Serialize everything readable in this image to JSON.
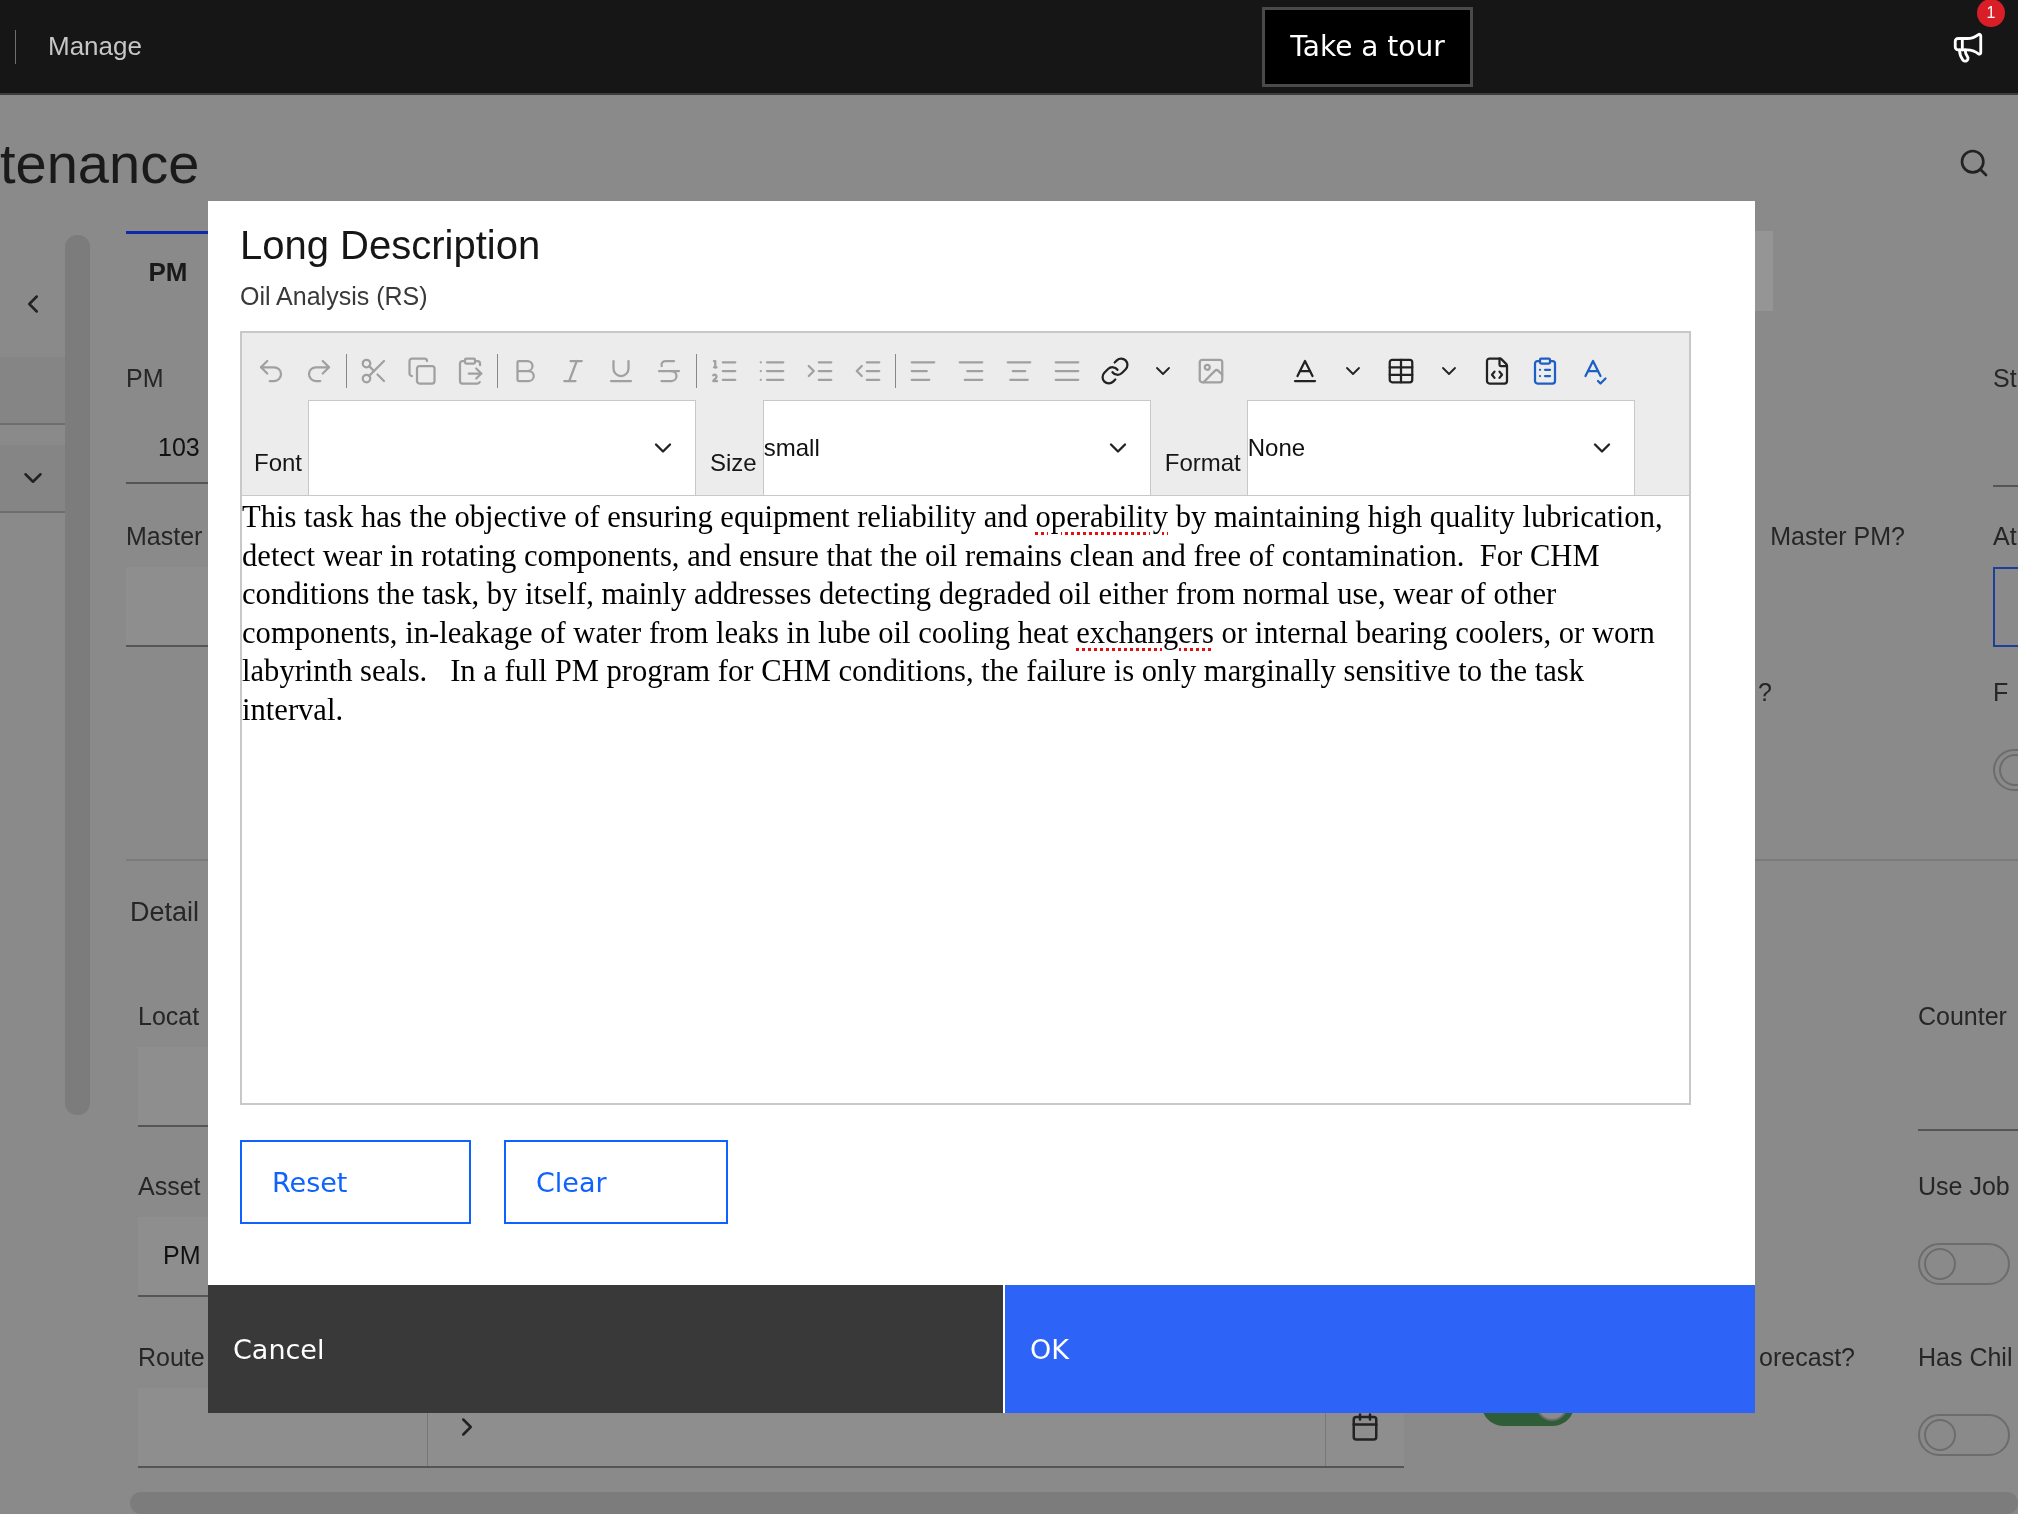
{
  "header": {
    "app_name": "Manage",
    "tour_button": "Take a tour",
    "notification_count": "1"
  },
  "page": {
    "title": "tenance",
    "tab": {
      "label": "PM",
      "selected": true
    },
    "pm_label": "PM",
    "pm_value": "103",
    "status_label": "St",
    "master_label": "Master",
    "master_question": "Master PM?",
    "attr_label": "At",
    "question_label": "?",
    "fo_label": "F",
    "fo_toggle": {
      "on": false
    },
    "details_heading": "Detail",
    "location_label": "Locat",
    "counter_label": "Counter",
    "asset_label": "Asset",
    "asset_value": "PM",
    "use_job_label": "Use Job",
    "use_job_toggle": {
      "on": false
    },
    "route_label": "Route",
    "forecast_label": "orecast?",
    "forecast_toggle": {
      "on": true
    },
    "has_child_label": "Has Chil",
    "has_child_toggle": {
      "on": false
    }
  },
  "dialog": {
    "title": "Long Description",
    "subtitle": "Oil Analysis (RS)",
    "toolbar": [
      {
        "kind": "undo",
        "disabled": true
      },
      {
        "kind": "redo",
        "disabled": true
      },
      {
        "kind": "separator"
      },
      {
        "kind": "cut",
        "disabled": true
      },
      {
        "kind": "copy",
        "disabled": true
      },
      {
        "kind": "paste",
        "disabled": true
      },
      {
        "kind": "separator"
      },
      {
        "kind": "bold",
        "disabled": true
      },
      {
        "kind": "italic",
        "disabled": true
      },
      {
        "kind": "underline",
        "disabled": true
      },
      {
        "kind": "strike",
        "disabled": true
      },
      {
        "kind": "separator"
      },
      {
        "kind": "numbered",
        "disabled": true
      },
      {
        "kind": "bulleted",
        "disabled": true
      },
      {
        "kind": "indent",
        "disabled": true
      },
      {
        "kind": "outdent",
        "disabled": true
      },
      {
        "kind": "separator"
      },
      {
        "kind": "align-left",
        "disabled": true
      },
      {
        "kind": "align-right",
        "disabled": true
      },
      {
        "kind": "align-center",
        "disabled": true
      },
      {
        "kind": "justify",
        "disabled": true
      },
      {
        "kind": "link",
        "disabled": false
      },
      {
        "kind": "dropdown",
        "disabled": false
      },
      {
        "kind": "image",
        "disabled": true
      },
      {
        "kind": "gap"
      },
      {
        "kind": "text-color",
        "disabled": false
      },
      {
        "kind": "dropdown",
        "disabled": false
      },
      {
        "kind": "table",
        "disabled": false
      },
      {
        "kind": "dropdown",
        "disabled": false
      },
      {
        "kind": "source",
        "disabled": false
      },
      {
        "kind": "paste-word",
        "disabled": false
      },
      {
        "kind": "spellcheck",
        "disabled": false
      }
    ],
    "selects": [
      {
        "label": "Font"
      },
      {
        "label": "Size",
        "value": "small"
      },
      {
        "label": "Format",
        "value": "None"
      }
    ],
    "body": [
      {
        "text": "This task has the objective of ensuring equipment reliability and ",
        "misspelled": false
      },
      {
        "text": "operability",
        "misspelled": true
      },
      {
        "text": " by maintaining high quality lubrication, detect wear in rotating components, and ensure that the oil remains clean and free of contamination.  For CHM conditions the task, by itself, mainly addresses detecting degraded oil either from normal use, wear of other components, in-leakage of water from leaks in lube oil cooling heat ",
        "misspelled": false
      },
      {
        "text": "exchangers",
        "misspelled": true
      },
      {
        "text": " or internal bearing coolers, or worn labyrinth seals.   In a full PM program for CHM conditions, the failure is only marginally sensitive to the task interval.",
        "misspelled": false
      }
    ],
    "reset_button": "Reset",
    "clear_button": "Clear",
    "cancel_button": "Cancel",
    "ok_button": "OK"
  }
}
